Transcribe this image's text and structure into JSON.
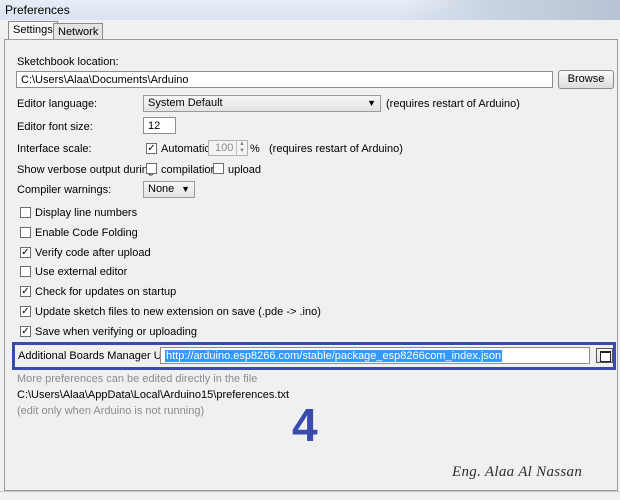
{
  "window": {
    "title": "Preferences"
  },
  "tabs": [
    {
      "label": "Settings",
      "active": true
    },
    {
      "label": "Network",
      "active": false
    }
  ],
  "sketchbook": {
    "label": "Sketchbook location:",
    "value": "C:\\Users\\Alaa\\Documents\\Arduino",
    "browse_label": "Browse"
  },
  "editor_language": {
    "label": "Editor language:",
    "value": "System Default",
    "note": "(requires restart of Arduino)"
  },
  "editor_font_size": {
    "label": "Editor font size:",
    "value": "12"
  },
  "interface_scale": {
    "label": "Interface scale:",
    "automatic_label": "Automatic",
    "automatic_checked": true,
    "value": "100",
    "unit": "%",
    "note": "(requires restart of Arduino)"
  },
  "verbose": {
    "label": "Show verbose output during:",
    "options": [
      {
        "label": "compilation",
        "checked": false
      },
      {
        "label": "upload",
        "checked": false
      }
    ]
  },
  "compiler_warnings": {
    "label": "Compiler warnings:",
    "value": "None"
  },
  "options": [
    {
      "label": "Display line numbers",
      "checked": false
    },
    {
      "label": "Enable Code Folding",
      "checked": false
    },
    {
      "label": "Verify code after upload",
      "checked": true
    },
    {
      "label": "Use external editor",
      "checked": false
    },
    {
      "label": "Check for updates on startup",
      "checked": true
    },
    {
      "label": "Update sketch files to new extension on save (.pde -> .ino)",
      "checked": true
    },
    {
      "label": "Save when verifying or uploading",
      "checked": true
    }
  ],
  "boards_manager": {
    "label": "Additional Boards Manager URLs:",
    "value": "http://arduino.esp8266.com/stable/package_esp8266com_index.json"
  },
  "footer": {
    "more_prefs": "More preferences can be edited directly in the file",
    "path": "C:\\Users\\Alaa\\AppData\\Local\\Arduino15\\preferences.txt",
    "note": "(edit only when Arduino is not running)"
  },
  "annotation": {
    "step": "4",
    "signature": "Eng. Alaa Al Nassan"
  },
  "colors": {
    "highlight": "#3a4bb0",
    "selection": "#3399ff"
  }
}
